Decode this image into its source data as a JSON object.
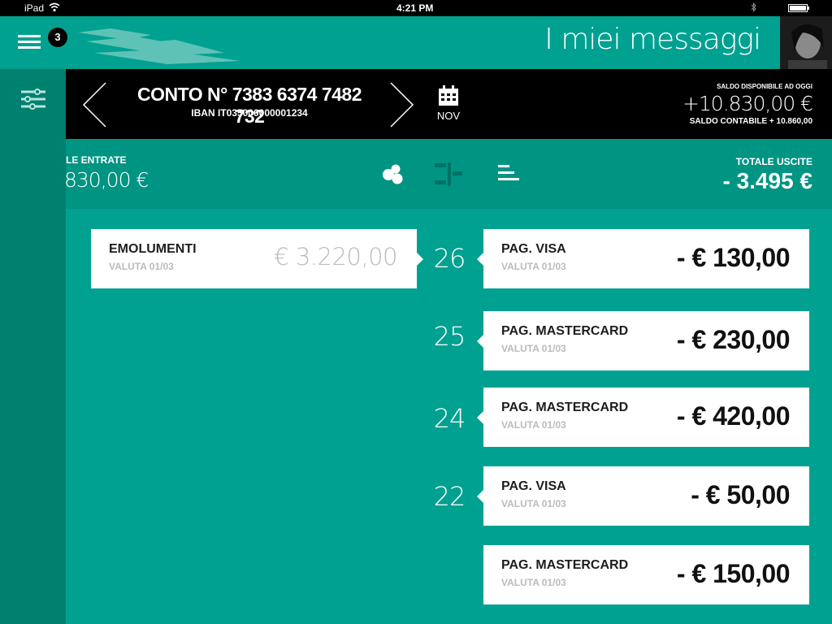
{
  "status_bar": {
    "device": "iPad",
    "time": "4:21 PM"
  },
  "header": {
    "badge_count": "3",
    "title": "I miei messaggi"
  },
  "account": {
    "number": "CONTO N° 7383 6374 7482 732",
    "iban": "IBAN IT035000000001234",
    "month": "NOV",
    "balance_label": "SALDO DISPONIBILE AD OGGI",
    "balance_value": "+10.830,00 €",
    "accounting_balance": "SALDO CONTABILE + 10.860,00"
  },
  "totals": {
    "income_label": "LE ENTRATE",
    "income_value": "830,00 €",
    "expense_label": "TOTALE USCITE",
    "expense_value": "- 3.495 €"
  },
  "income": [
    {
      "title": "EMOLUMENTI",
      "sub": "VALUTA 01/03",
      "amount": "€ 3.220,00"
    }
  ],
  "expenses": [
    {
      "day": "26",
      "title": "PAG. VISA",
      "sub": "VALUTA 01/03",
      "amount": "- € 130,00"
    },
    {
      "day": "25",
      "title": "PAG. MASTERCARD",
      "sub": "VALUTA 01/03",
      "amount": "- € 230,00"
    },
    {
      "day": "24",
      "title": "PAG. MASTERCARD",
      "sub": "VALUTA 01/03",
      "amount": "- € 420,00"
    },
    {
      "day": "22",
      "title": "PAG. VISA",
      "sub": "VALUTA 01/03",
      "amount": "- € 50,00"
    },
    {
      "day": "",
      "title": "PAG. MASTERCARD",
      "sub": "VALUTA 01/03",
      "amount": "- € 150,00"
    }
  ],
  "colors": {
    "teal": "#00a190",
    "teal_dark": "#00806f",
    "teal_mid": "#009483",
    "black": "#000000"
  }
}
